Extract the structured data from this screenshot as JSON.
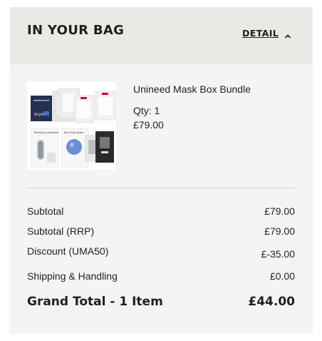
{
  "bag": {
    "title": "IN YOUR BAG",
    "detail_label": "DETAIL",
    "detail_icon": "chevron-up-icon"
  },
  "item": {
    "name": "Unineed Mask Box Bundle",
    "qty": "Qty: 1",
    "price": "£79.00",
    "image_icon": "mask-bundle-thumbnail",
    "image_text": {
      "tile1": "DR.JART",
      "tile4": "Refreshing Sensitive",
      "tile5": "Blue Glow Hydro"
    }
  },
  "summary": {
    "rows": [
      {
        "label": "Subtotal",
        "value": "£79.00"
      },
      {
        "label": "Subtotal (RRP)",
        "value": "£79.00"
      },
      {
        "label": "Discount (UMA50)",
        "value": "£-35.00"
      },
      {
        "label": "Shipping & Handling",
        "value": "£0.00"
      }
    ],
    "grand_label": "Grand Total - 1 Item",
    "grand_value": "£44.00"
  },
  "colors": {
    "panel_bg": "#f5f4f2",
    "header_bg": "#ebe9e5",
    "text": "#222222",
    "mask_navy": "#24304f",
    "mask_red": "#c8102e",
    "mask_blue": "#6e8ed4"
  }
}
